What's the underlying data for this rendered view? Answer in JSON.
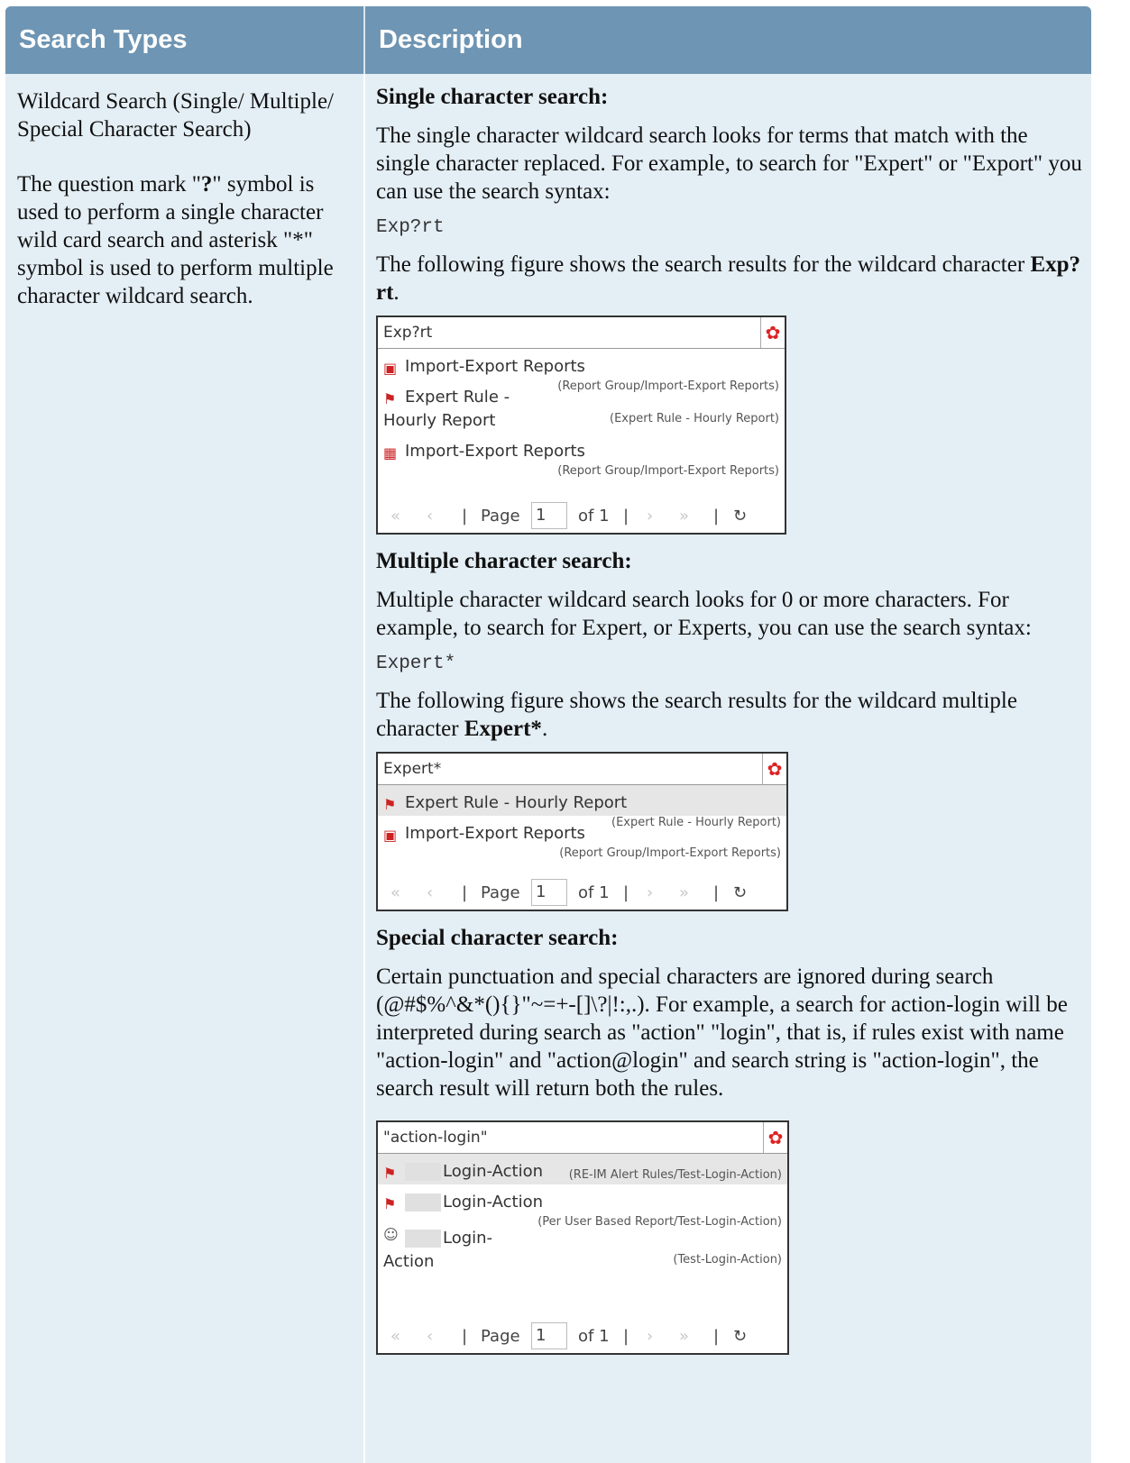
{
  "header": {
    "col1": "Search Types",
    "col2": "Description"
  },
  "left": {
    "title": "Wildcard Search (Single/ Multiple/ Special Character Search)",
    "desc_pre": " The question mark \"",
    "desc_q": "?",
    "desc_post": "\" symbol is used to perform a single character wild card search and asterisk \"*\" symbol is used to perform multiple character wildcard search."
  },
  "single": {
    "heading": "Single character search:",
    "p1": "The single character wildcard search looks for terms that match with the single character replaced. For example, to search for \"Expert\" or \"Export\" you can use the search syntax:",
    "code": "Exp?rt",
    "p2_pre": "The following figure shows the search results for the wildcard character ",
    "p2_bold": "Exp?rt",
    "p2_post": ".",
    "shot": {
      "query": "Exp?rt",
      "results": [
        {
          "name": "Import-Export Reports",
          "path": "(Report Group/Import-Export Reports)"
        },
        {
          "name_line1": "Expert Rule -",
          "name_line2": "Hourly Report",
          "path": "(Expert Rule - Hourly Report)"
        },
        {
          "name": "Import-Export Reports",
          "path": "(Report Group/Import-Export Reports)"
        }
      ]
    }
  },
  "multiple": {
    "heading": "Multiple character search:",
    "p1": "Multiple character wildcard search looks for 0 or more characters. For example, to search for Expert, or Experts, you can use the search syntax:",
    "code": "Expert*",
    "p2_pre": "The following figure shows the search results for the wildcard multiple character ",
    "p2_bold": "Expert*",
    "p2_post": ".",
    "shot": {
      "query": "Expert*",
      "results": [
        {
          "name": "Expert Rule - Hourly Report",
          "path": "(Expert Rule - Hourly Report)"
        },
        {
          "name": "Import-Export Reports",
          "path": "(Report Group/Import-Export Reports)"
        }
      ]
    }
  },
  "special": {
    "heading": "Special character search:",
    "p1": "Certain punctuation and special characters are ignored during search (@#$%^&*(){}\"~=+-[]\\?|!:,.). For example, a search for action-login will be interpreted during search as \"action\" \"login\", that is, if rules exist with name \"action-login\" and \"action@login\" and search string is \"action-login\", the search result will return both the rules.",
    "shot": {
      "query": "\"action-login\"",
      "results": [
        {
          "name": "Login-Action",
          "path": "(RE-IM Alert Rules/Test-Login-Action)"
        },
        {
          "name": "Login-Action",
          "path": "(Per User Based Report/Test-Login-Action)"
        },
        {
          "name_line1": "Login-",
          "name_line2": "Action",
          "path": "(Test-Login-Action)"
        }
      ]
    }
  },
  "pager": {
    "page_label": "Page",
    "page_value": "1",
    "of_label": "of 1"
  }
}
